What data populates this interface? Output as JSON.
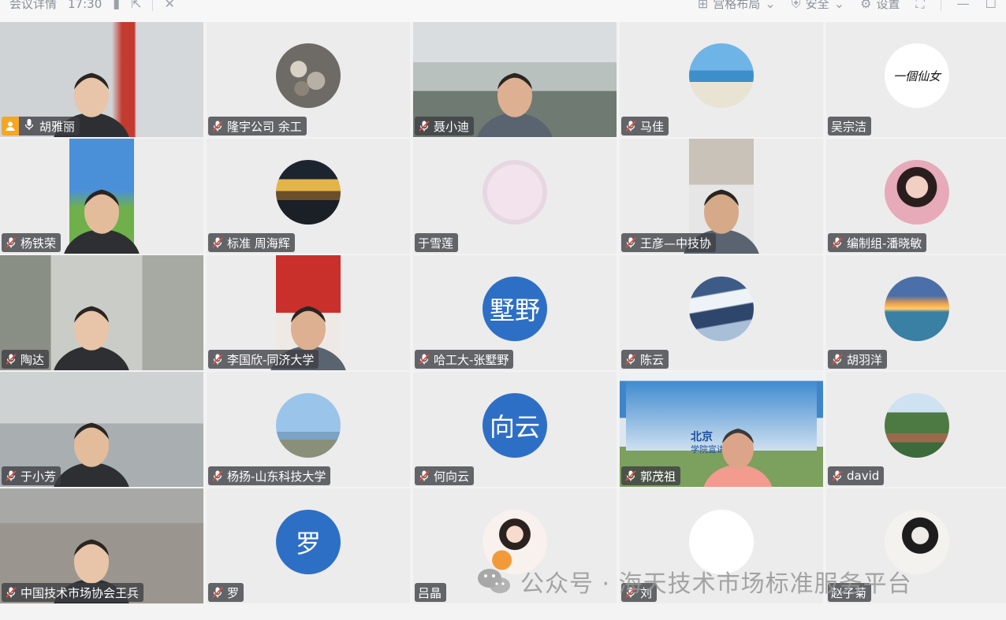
{
  "topbar": {
    "title": "会议详情",
    "time": "17:30",
    "layout_label": "宫格布局",
    "security_label": "安全",
    "settings_label": "设置"
  },
  "participants": [
    {
      "name": "胡雅丽",
      "kind": "video",
      "host": true
    },
    {
      "name": "隆宇公司 余工",
      "kind": "avatar-img",
      "avatar": "stones"
    },
    {
      "name": "聂小迪",
      "kind": "video"
    },
    {
      "name": "马佳",
      "kind": "avatar-img",
      "avatar": "beach"
    },
    {
      "name": "吴宗洁",
      "kind": "avatar-img",
      "avatar": "calligraphy",
      "avatar_text": "一個仙女",
      "unmuted": true
    },
    {
      "name": "杨铁荣",
      "kind": "video"
    },
    {
      "name": "标准 周海辉",
      "kind": "avatar-img",
      "avatar": "mountain-sunset"
    },
    {
      "name": "于雪莲",
      "kind": "avatar-img",
      "avatar": "logo-yu",
      "unmuted": true
    },
    {
      "name": "王彦—中技协",
      "kind": "video"
    },
    {
      "name": "编制组-潘晓敏",
      "kind": "avatar-img",
      "avatar": "girl"
    },
    {
      "name": "陶达",
      "kind": "video"
    },
    {
      "name": "李国欣-同济大学",
      "kind": "video"
    },
    {
      "name": "哈工大-张墅野",
      "kind": "avatar-text",
      "avatar_text": "墅野"
    },
    {
      "name": "陈云",
      "kind": "avatar-img",
      "avatar": "snow-mountain"
    },
    {
      "name": "胡羽洋",
      "kind": "avatar-img",
      "avatar": "sea-sunset"
    },
    {
      "name": "于小芳",
      "kind": "video"
    },
    {
      "name": "杨扬-山东科技大学",
      "kind": "avatar-img",
      "avatar": "coast"
    },
    {
      "name": "何向云",
      "kind": "avatar-text",
      "avatar_text": "向云"
    },
    {
      "name": "郭茂祖",
      "kind": "video",
      "screen_text": "北京",
      "screen_sub": "学院宣讲"
    },
    {
      "name": "david",
      "kind": "avatar-img",
      "avatar": "campus"
    },
    {
      "name": "中国技术市场协会王兵",
      "kind": "video"
    },
    {
      "name": "罗",
      "kind": "avatar-text",
      "avatar_text": "罗"
    },
    {
      "name": "吕晶",
      "kind": "avatar-img",
      "avatar": "cartoon-girl",
      "unmuted": true
    },
    {
      "name": "刘",
      "kind": "avatar-img",
      "avatar": "blank"
    },
    {
      "name": "赵子菊",
      "kind": "avatar-img",
      "avatar": "sketch-girl",
      "unmuted": true
    }
  ],
  "watermark": {
    "text": "公众号 · 海天技术市场标准服务平台"
  },
  "colors": {
    "avatar_blue": "#2e6fc6",
    "host_badge": "#f5a623",
    "label_bg": "#3c3e42"
  }
}
